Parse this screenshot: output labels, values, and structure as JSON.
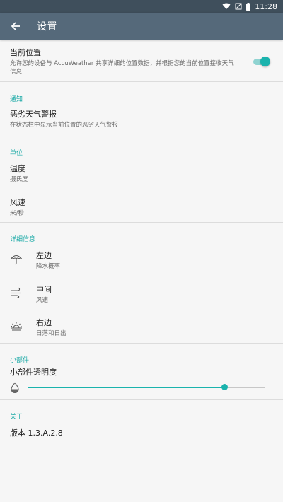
{
  "status_bar": {
    "time": "11:28"
  },
  "app_bar": {
    "title": "设置"
  },
  "location": {
    "title": "当前位置",
    "desc": "允许您的设备与 AccuWeather 共享详细的位置数据，并根据您的当前位置接收天气信息",
    "toggle_on": true
  },
  "notifications": {
    "header": "通知",
    "severe": {
      "title": "恶劣天气警报",
      "desc": "在状态栏中显示当前位置的恶劣天气警报"
    }
  },
  "units": {
    "header": "单位",
    "temperature": {
      "title": "温度",
      "value": "摄氏度"
    },
    "wind": {
      "title": "风速",
      "value": "米/秒"
    }
  },
  "details": {
    "header": "详细信息",
    "items": [
      {
        "icon": "umbrella-icon",
        "title": "左边",
        "value": "降水概率"
      },
      {
        "icon": "wind-icon",
        "title": "中间",
        "value": "风速"
      },
      {
        "icon": "sunrise-icon",
        "title": "右边",
        "value": "日落和日出"
      }
    ]
  },
  "widget": {
    "header": "小部件",
    "transparency_label": "小部件透明度",
    "transparency_value": 0.83,
    "icon": "drop-icon"
  },
  "about": {
    "header": "关于",
    "version": "版本 1.3.A.2.8"
  },
  "colors": {
    "accent": "#1ab3ad",
    "appbar": "#55697a",
    "statusbar": "#3f4f5c",
    "section_header": "#1aa9a6"
  }
}
